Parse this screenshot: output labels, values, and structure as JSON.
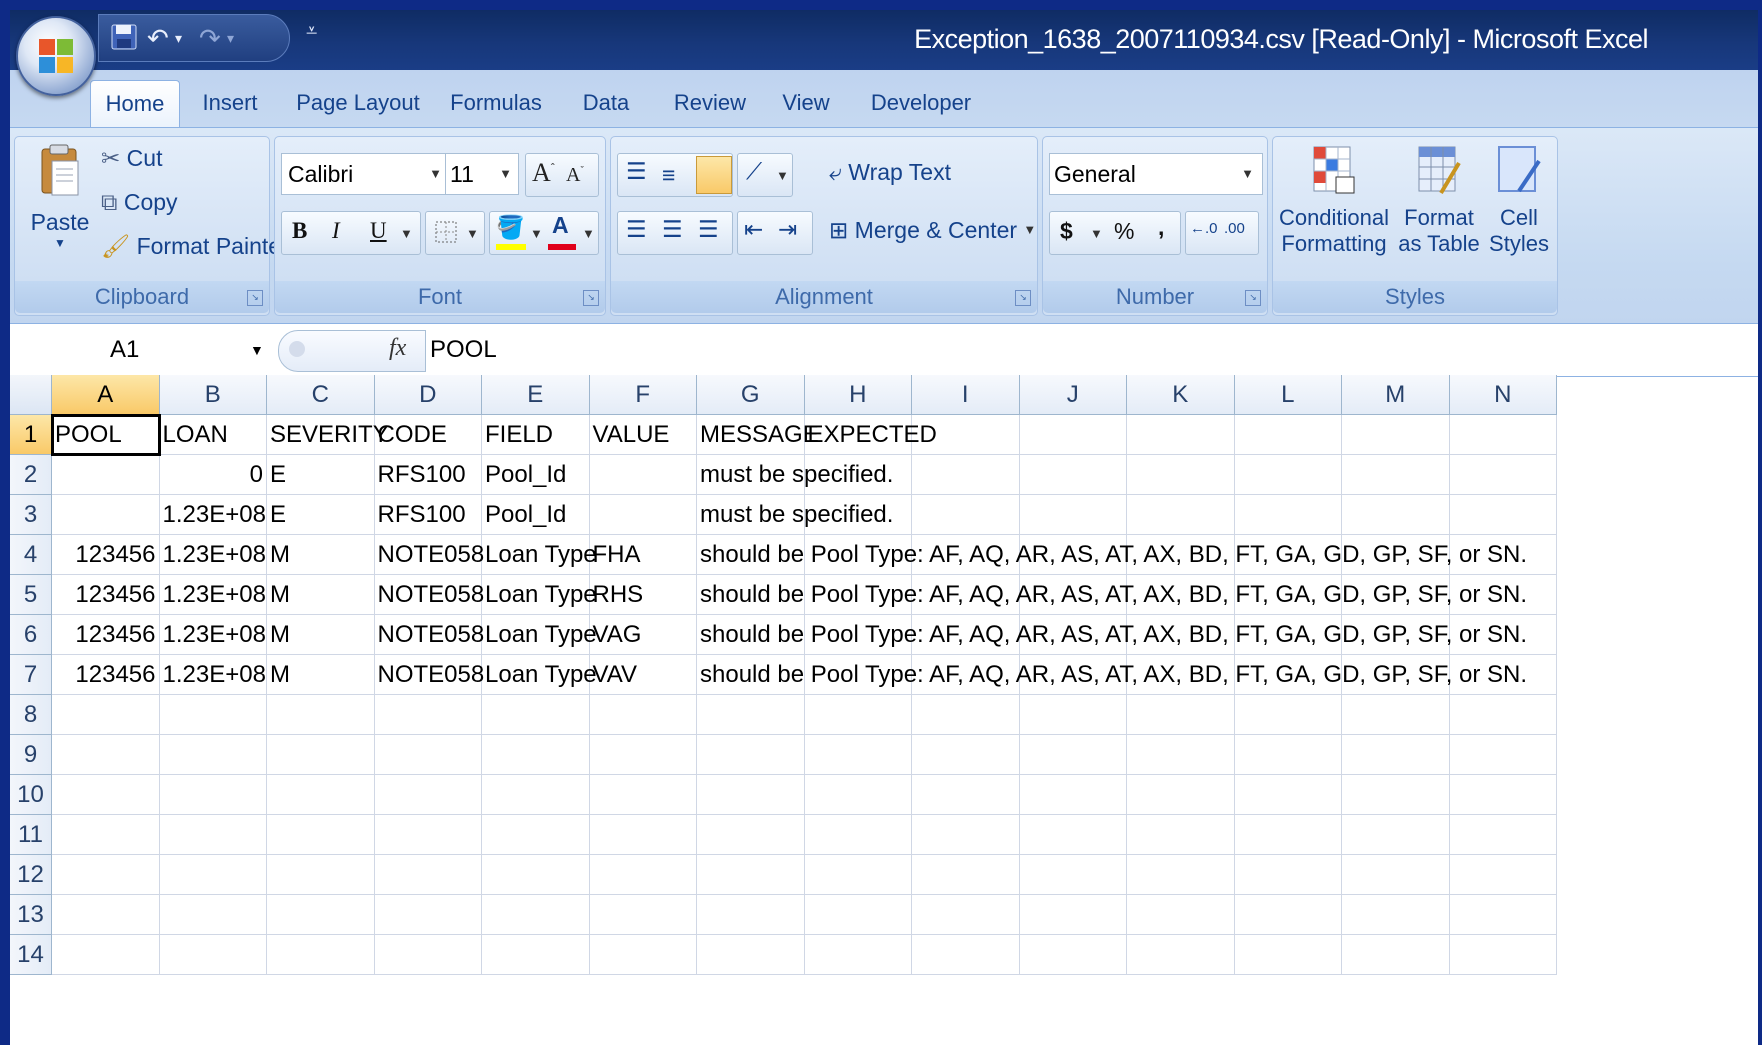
{
  "window": {
    "title": "Exception_1638_2007110934.csv  [Read-Only] - Microsoft Excel"
  },
  "ribbon": {
    "tabs": [
      "Home",
      "Insert",
      "Page Layout",
      "Formulas",
      "Data",
      "Review",
      "View",
      "Developer"
    ],
    "active_tab": "Home",
    "clipboard": {
      "paste": "Paste",
      "cut": "Cut",
      "copy": "Copy",
      "format_painter": "Format Painter",
      "group": "Clipboard"
    },
    "font": {
      "font_name": "Calibri",
      "font_size": "11",
      "bold": "B",
      "italic": "I",
      "underline": "U",
      "font_color_glyph": "A",
      "group": "Font"
    },
    "alignment": {
      "wrap_text": "Wrap Text",
      "merge_center": "Merge & Center",
      "group": "Alignment"
    },
    "number": {
      "format": "General",
      "currency": "$",
      "percent": "%",
      "comma": ",",
      "group": "Number"
    },
    "styles": {
      "conditional_1": "Conditional",
      "conditional_2": "Formatting",
      "format_table_1": "Format",
      "format_table_2": "as Table",
      "cell_styles_1": "Cell",
      "cell_styles_2": "Styles",
      "group": "Styles"
    }
  },
  "formula_bar": {
    "name_box": "A1",
    "fx": "fx",
    "value": "POOL"
  },
  "sheet": {
    "columns": [
      "A",
      "B",
      "C",
      "D",
      "E",
      "F",
      "G",
      "H",
      "I",
      "J",
      "K",
      "L",
      "M",
      "N"
    ],
    "row_numbers": [
      "1",
      "2",
      "3",
      "4",
      "5",
      "6",
      "7",
      "8",
      "9",
      "10",
      "11",
      "12",
      "13",
      "14"
    ],
    "rows": [
      [
        "POOL",
        "LOAN",
        "SEVERITY",
        "CODE",
        "FIELD",
        "VALUE",
        "MESSAGE",
        "EXPECTED"
      ],
      [
        "",
        "0",
        "E",
        "RFS100",
        "Pool_Id",
        "",
        "must be specified.",
        ""
      ],
      [
        "",
        "1.23E+08",
        "E",
        "RFS100",
        "Pool_Id",
        "",
        "must be specified.",
        ""
      ],
      [
        "123456",
        "1.23E+08",
        "M",
        "NOTE058",
        "Loan Type",
        "FHA",
        "should be Pool Type: AF, AQ, AR, AS, AT, AX, BD, FT, GA, GD, GP, SF, or SN.",
        ""
      ],
      [
        "123456",
        "1.23E+08",
        "M",
        "NOTE058",
        "Loan Type",
        "RHS",
        "should be Pool Type: AF, AQ, AR, AS, AT, AX, BD, FT, GA, GD, GP, SF, or SN.",
        ""
      ],
      [
        "123456",
        "1.23E+08",
        "M",
        "NOTE058",
        "Loan Type",
        "VAG",
        "should be Pool Type: AF, AQ, AR, AS, AT, AX, BD, FT, GA, GD, GP, SF, or SN.",
        ""
      ],
      [
        "123456",
        "1.23E+08",
        "M",
        "NOTE058",
        "Loan Type",
        "VAV",
        "should be Pool Type: AF, AQ, AR, AS, AT, AX, BD, FT, GA, GD, GP, SF, or SN.",
        ""
      ]
    ],
    "numeric_columns": [
      0,
      1
    ],
    "active_cell": "A1"
  },
  "colors": {
    "desktop": "#0e2a86",
    "ribbon": "#c5d9f1",
    "tab_text": "#15428b",
    "selected_header": "#f9c968"
  }
}
